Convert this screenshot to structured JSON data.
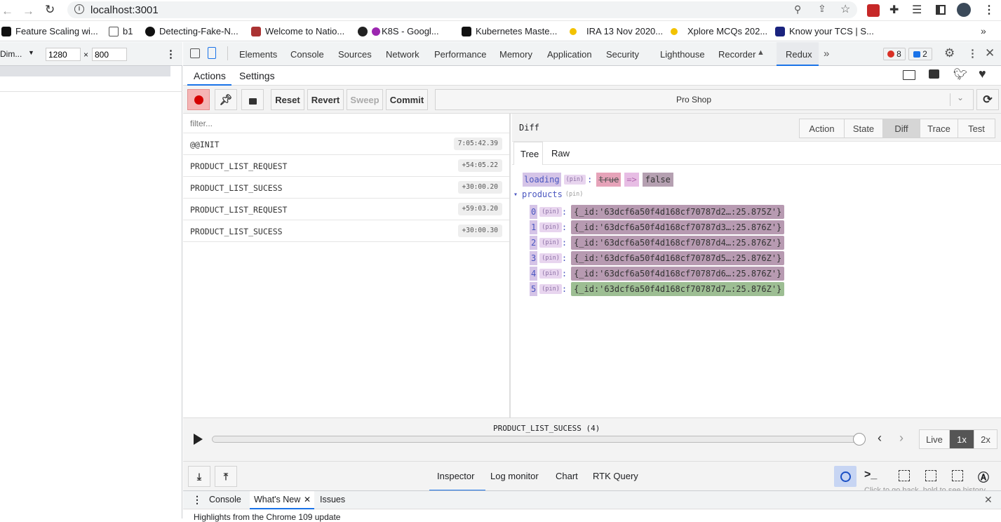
{
  "browser": {
    "url": "localhost:3001",
    "bookmarks": [
      {
        "label": "Feature Scaling wi..."
      },
      {
        "label": "b1"
      },
      {
        "label": "Detecting-Fake-N..."
      },
      {
        "label": "Welcome to Natio..."
      },
      {
        "label": "K8S - Googl..."
      },
      {
        "label": "Kubernetes Maste..."
      },
      {
        "label": "IRA 13 Nov 2020..."
      },
      {
        "label": "Xplore MCQs 202..."
      },
      {
        "label": "Know your TCS | S..."
      }
    ]
  },
  "device": {
    "label": "Dim...",
    "width": "1280",
    "height": "800",
    "times": "×"
  },
  "devtools": {
    "tabs": [
      "Elements",
      "Console",
      "Sources",
      "Network",
      "Performance",
      "Memory",
      "Application",
      "Security",
      "Lighthouse",
      "Recorder",
      "Redux"
    ],
    "error_count": "8",
    "message_count": "2"
  },
  "redux": {
    "top_tabs": [
      "Actions",
      "Settings"
    ],
    "toolbar": {
      "reset": "Reset",
      "revert": "Revert",
      "sweep": "Sweep",
      "commit": "Commit",
      "instance": "Pro Shop"
    },
    "filter_placeholder": "filter...",
    "actions": [
      {
        "name": "@@INIT",
        "time": "7:05:42.39"
      },
      {
        "name": "PRODUCT_LIST_REQUEST",
        "time": "+54:05.22"
      },
      {
        "name": "PRODUCT_LIST_SUCESS",
        "time": "+30:00.20"
      },
      {
        "name": "PRODUCT_LIST_REQUEST",
        "time": "+59:03.20"
      },
      {
        "name": "PRODUCT_LIST_SUCESS",
        "time": "+30:00.30"
      }
    ],
    "diff": {
      "title": "Diff",
      "tabs": [
        "Action",
        "State",
        "Diff",
        "Trace",
        "Test"
      ],
      "subtabs": [
        "Tree",
        "Raw"
      ],
      "loading_key": "loading",
      "pin": "(pin)",
      "colon": ":",
      "old": "true",
      "arrow": "=>",
      "new": "false",
      "toggle": "▾",
      "products_key": "products",
      "products": [
        {
          "index": "0",
          "value": "{_id:'63dcf6a50f4d168cf70787d2…:25.875Z'}"
        },
        {
          "index": "1",
          "value": "{_id:'63dcf6a50f4d168cf70787d3…:25.876Z'}"
        },
        {
          "index": "2",
          "value": "{_id:'63dcf6a50f4d168cf70787d4…:25.876Z'}"
        },
        {
          "index": "3",
          "value": "{_id:'63dcf6a50f4d168cf70787d5…:25.876Z'}"
        },
        {
          "index": "4",
          "value": "{_id:'63dcf6a50f4d168cf70787d6…:25.876Z'}"
        },
        {
          "index": "5",
          "value": "{_id:'63dcf6a50f4d168cf70787d7…:25.876Z'}"
        }
      ]
    },
    "slider": {
      "label": "PRODUCT_LIST_SUCESS (4)",
      "live": "Live",
      "speed1": "1x",
      "speed2": "2x"
    },
    "monitors": [
      "Inspector",
      "Log monitor",
      "Chart",
      "RTK Query"
    ],
    "tooltip": "Click to go back, hold to see history"
  },
  "drawer": {
    "tabs": [
      "Console",
      "What's New",
      "Issues"
    ],
    "highlight": "Highlights from the Chrome 109 update"
  }
}
